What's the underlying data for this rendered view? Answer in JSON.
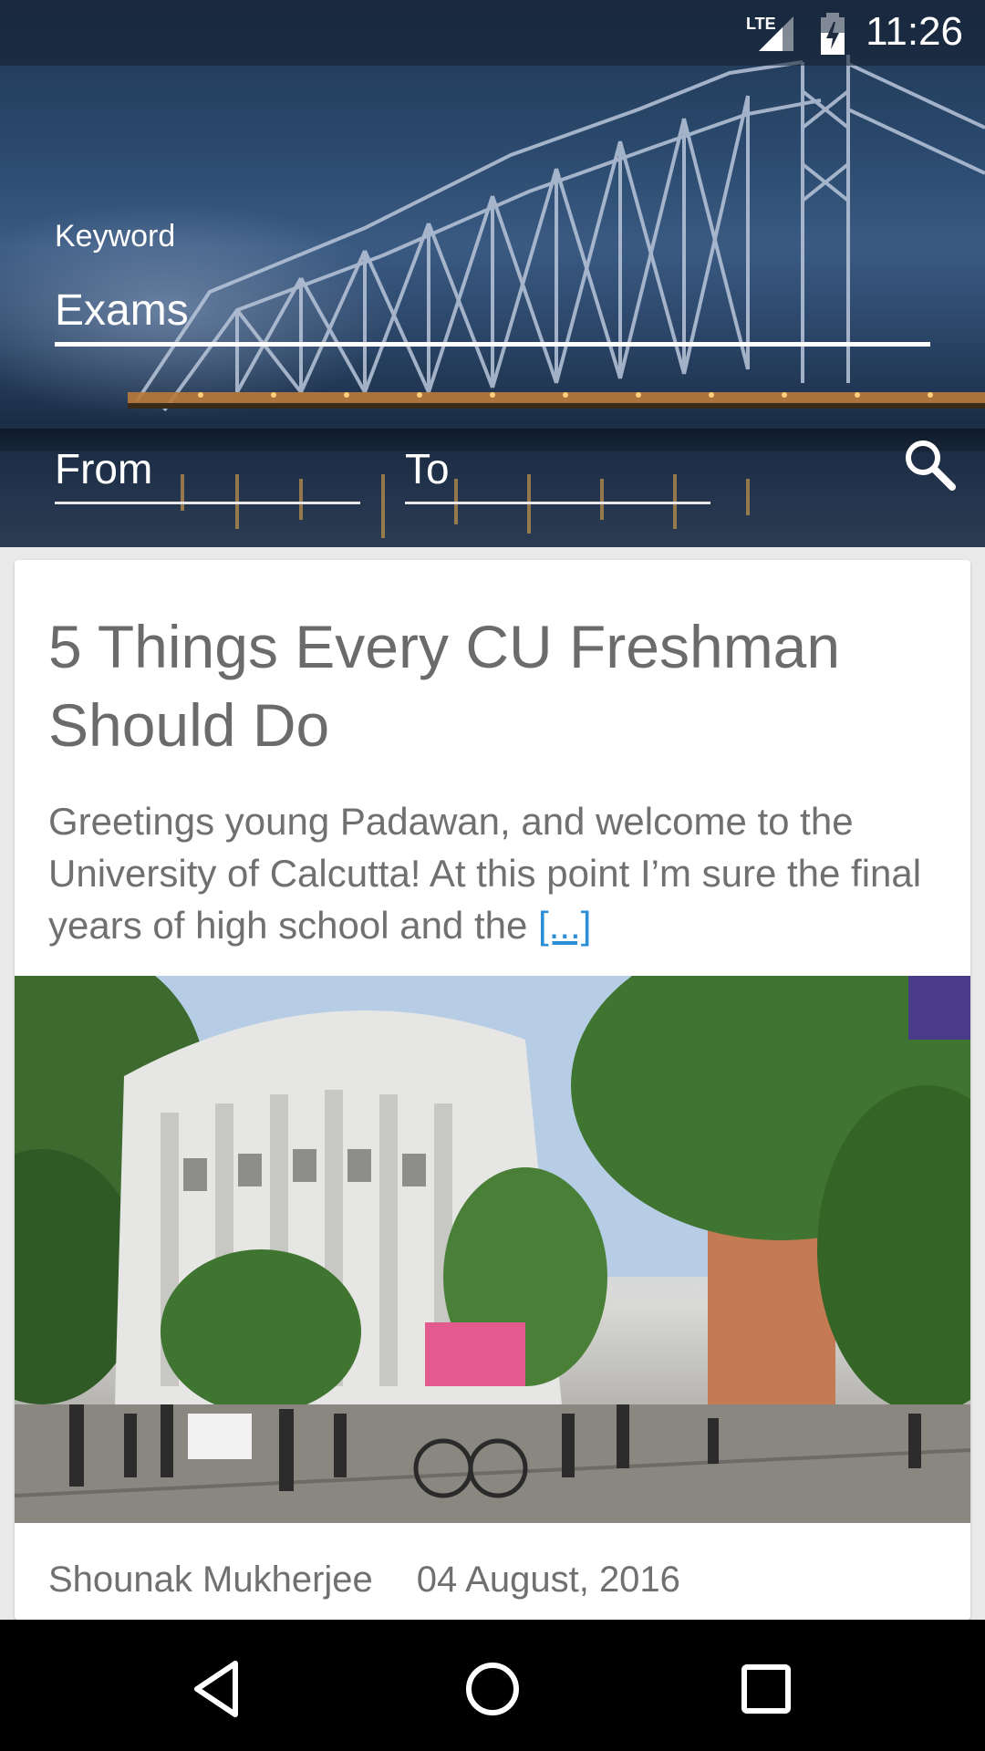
{
  "status_bar": {
    "time": "11:26",
    "network": "LTE",
    "icons": [
      "lte-signal-icon",
      "battery-charging-icon"
    ]
  },
  "search": {
    "keyword_label": "Keyword",
    "keyword_value": "Exams",
    "from_placeholder": "From",
    "to_placeholder": "To",
    "search_icon": "search-icon"
  },
  "article": {
    "title": "5 Things Every CU Freshman Should Do",
    "excerpt": "Greetings young Padawan, and welcome to the University of Calcutta! At this point I’m sure the final years of high school and the",
    "read_more": "[...]",
    "author": "Shounak Mukherjee",
    "date": "04 August, 2016"
  },
  "nav_bar": {
    "icons": [
      "back-icon",
      "home-icon",
      "recents-icon"
    ]
  },
  "colors": {
    "link": "#2a8fd6",
    "text_muted": "#707070",
    "nav_background": "#000000"
  }
}
